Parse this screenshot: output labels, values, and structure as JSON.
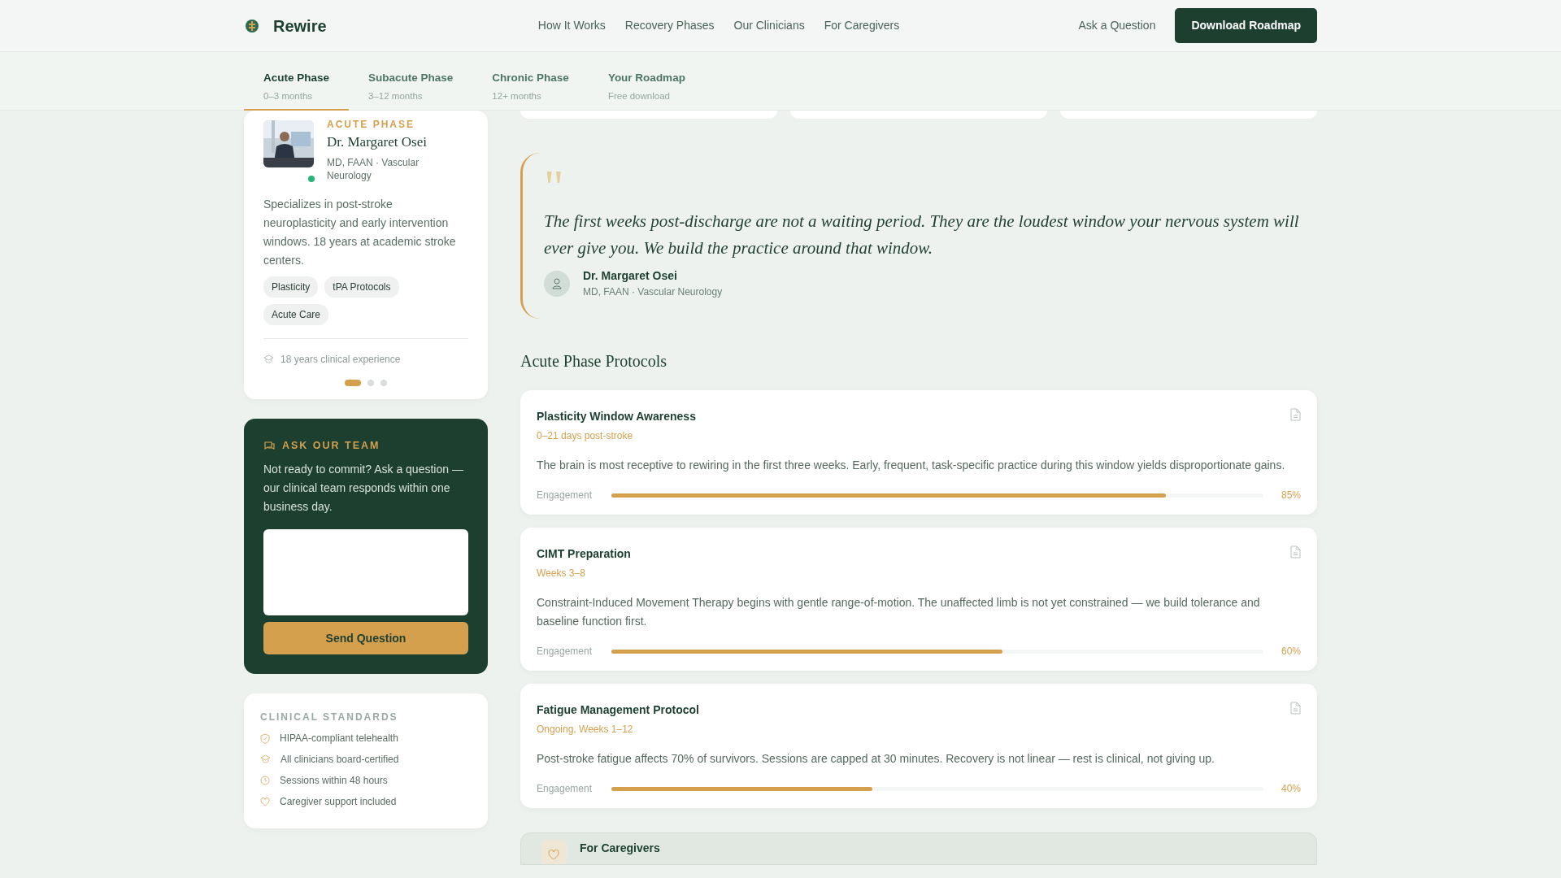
{
  "header": {
    "brand": "Rewire",
    "nav": [
      "How It Works",
      "Recovery Phases",
      "Our Clinicians",
      "For Caregivers"
    ],
    "ask_link": "Ask a Question",
    "cta": "Download Roadmap"
  },
  "tabs": [
    {
      "label": "Acute Phase",
      "sub": "0–3 months",
      "selected": true
    },
    {
      "label": "Subacute Phase",
      "sub": "3–12 months",
      "selected": false
    },
    {
      "label": "Chronic Phase",
      "sub": "12+ months",
      "selected": false
    },
    {
      "label": "Your Roadmap",
      "sub": "Free download",
      "selected": false
    }
  ],
  "clinician": {
    "phase": "ACUTE PHASE",
    "photo": {
      "kind": "picture"
    },
    "online": true,
    "name": "Dr. Margaret Osei",
    "credentials": "MD, FAAN · Vascular Neurology",
    "bio": "Specializes in post-stroke neuroplasticity and early intervention windows. 18 years at academic stroke centers.",
    "tags": [
      "Plasticity",
      "tPA Protocols",
      "Acute Care"
    ],
    "experience": "18 years clinical experience",
    "dots": [
      {
        "selected": true
      },
      {
        "selected": false
      },
      {
        "selected": false
      }
    ]
  },
  "ask": {
    "title": "ASK OUR TEAM",
    "text": "Not ready to commit? Ask a question — our clinical team responds within one business day.",
    "button": "Send Question"
  },
  "standards": {
    "title": "CLINICAL STANDARDS",
    "items": [
      {
        "kind": "shield",
        "text": "HIPAA-compliant telehealth"
      },
      {
        "kind": "cap",
        "text": "All clinicians board-certified"
      },
      {
        "kind": "clock",
        "text": "Sessions within 48 hours"
      },
      {
        "kind": "heart",
        "text": "Caregiver support included"
      }
    ]
  },
  "quote": {
    "mark": "\"",
    "text": "The first weeks post-discharge are not a waiting period. They are the loudest window your nervous system will ever give you. We build the practice around that window.",
    "author": "Dr. Margaret Osei",
    "role": "MD, FAAN · Vascular Neurology"
  },
  "protocols_heading": "Acute Phase Protocols",
  "protocols": [
    {
      "title": "Plasticity Window Awareness",
      "timing": "0–21 days post-stroke",
      "text": "The brain is most receptive to rewiring in the first three weeks. Early, frequent, task-specific practice during this window yields disproportionate gains.",
      "metric": "Engagement",
      "level": 0.85,
      "reading": "85%"
    },
    {
      "title": "CIMT Preparation",
      "timing": "Weeks 3–8",
      "text": "Constraint-Induced Movement Therapy begins with gentle range-of-motion. The unaffected limb is not yet constrained — we build tolerance and baseline function first.",
      "metric": "Engagement",
      "level": 0.6,
      "reading": "60%"
    },
    {
      "title": "Fatigue Management Protocol",
      "timing": "Ongoing, Weeks 1–12",
      "text": "Post-stroke fatigue affects 70% of survivors. Sessions are capped at 30 minutes. Recovery is not linear — rest is clinical, not giving up.",
      "metric": "Engagement",
      "level": 0.4,
      "reading": "40%"
    }
  ],
  "caregivers": {
    "title": "For Caregivers"
  }
}
